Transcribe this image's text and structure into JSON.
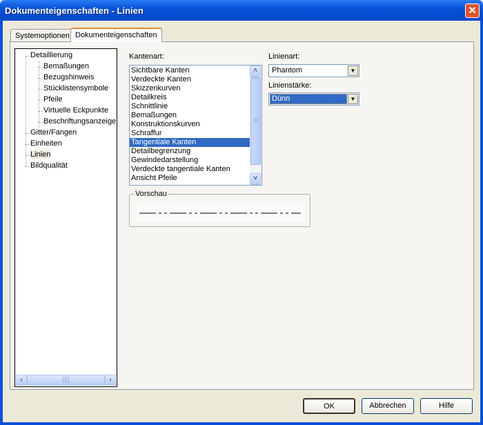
{
  "window": {
    "title": "Dokumenteigenschaften - Linien",
    "close_label": "✕"
  },
  "tabs": [
    {
      "label": "Systemoptionen"
    },
    {
      "label": "Dokumenteigenschaften"
    }
  ],
  "tree": {
    "items": [
      {
        "label": "Detaillierung"
      },
      {
        "label": "Bemaßungen"
      },
      {
        "label": "Bezugshinweis"
      },
      {
        "label": "Stücklistensymbole"
      },
      {
        "label": "Pfeile"
      },
      {
        "label": "Virtuelle Eckpunkte"
      },
      {
        "label": "Beschriftungsanzeige"
      },
      {
        "label": "Gitter/Fangen"
      },
      {
        "label": "Einheiten"
      },
      {
        "label": "Linien"
      },
      {
        "label": "Bildqualität"
      }
    ],
    "selected": "Linien"
  },
  "edge_type": {
    "label": "Kantenart:",
    "items": [
      "Sichtbare Kanten",
      "Verdeckte Kanten",
      "Skizzenkurven",
      "Detailkreis",
      "Schnittlinie",
      "Bemaßungen",
      "Konstruktionskurven",
      "Schraffur",
      "Tangentiale Kanten",
      "Detailbegrenzung",
      "Gewindedarstellung",
      "Verdeckte tangentiale Kanten",
      "Ansicht Pfeile"
    ],
    "selected": "Tangentiale Kanten"
  },
  "line_style": {
    "label": "Linienart:",
    "value": "Phantom"
  },
  "line_weight": {
    "label": "Linienstärke:",
    "value": "Dünn"
  },
  "preview": {
    "label": "Vorschau"
  },
  "buttons": {
    "ok": "OK",
    "cancel": "Abbrechen",
    "help": "Hilfe"
  }
}
